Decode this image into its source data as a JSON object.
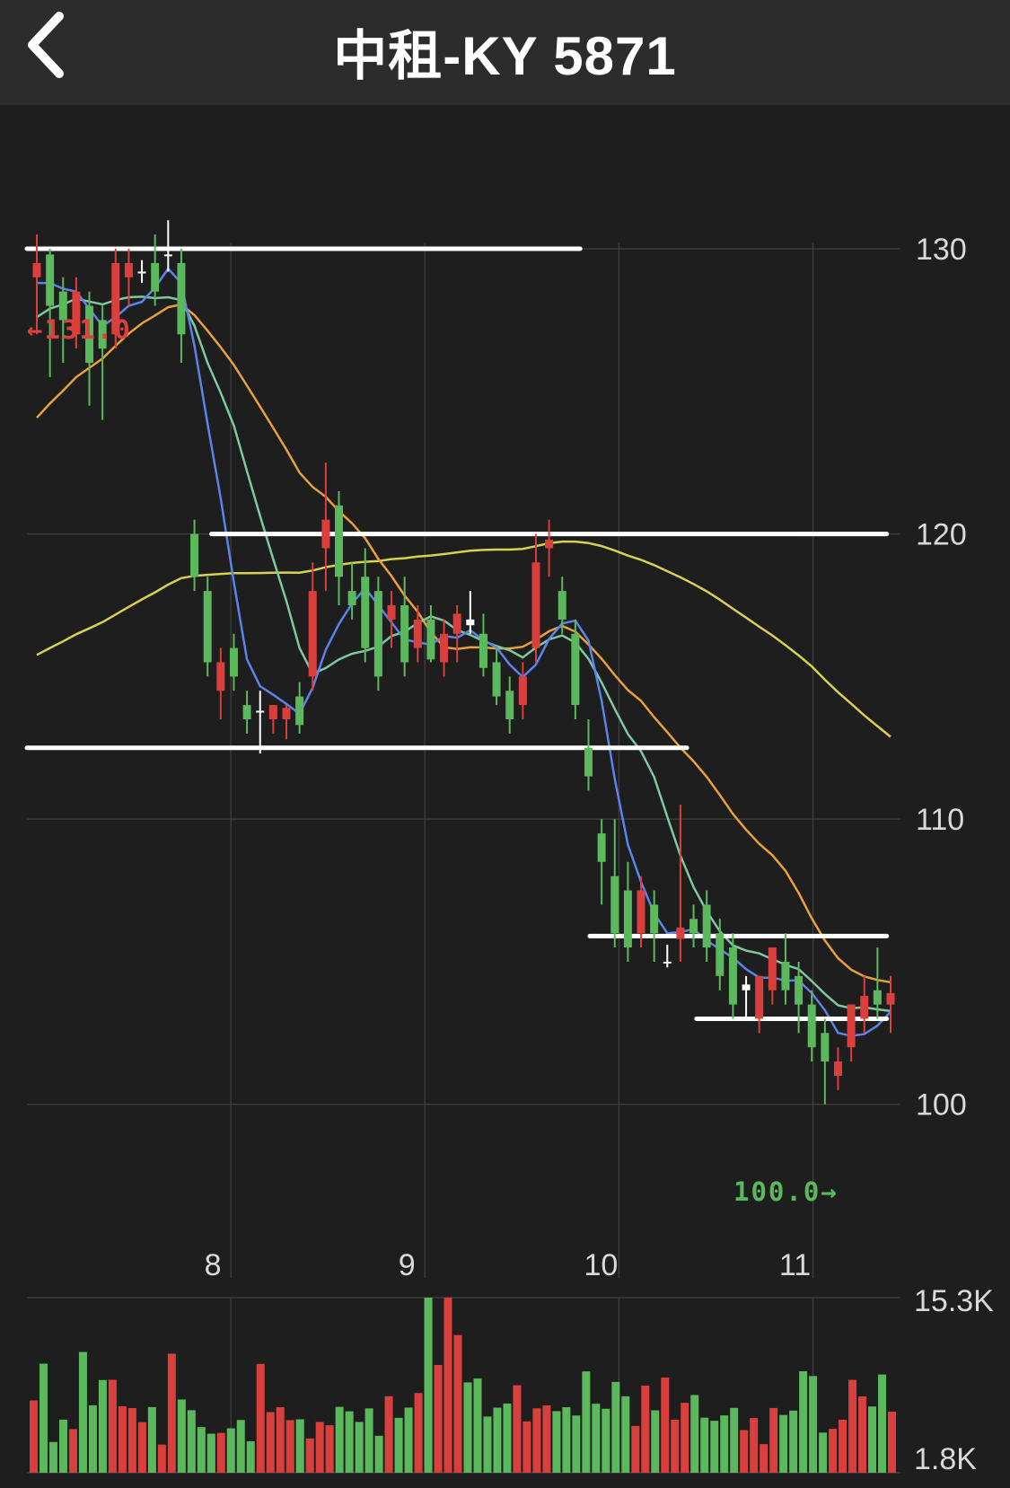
{
  "header": {
    "title": "中租-KY 5871",
    "back_icon": "chevron-left-icon"
  },
  "colors": {
    "up": "#d9403d",
    "down": "#5cb85c",
    "doji": "#ffffff",
    "ma5": "#5b84e8",
    "ma10": "#7ec8a0",
    "ma20": "#e8a03c",
    "ma60": "#d6d150",
    "support_line": "#ffffff",
    "grid": "#3a3a3a"
  },
  "chart_data": [
    {
      "type": "candlestick",
      "y_ticks": [
        "130",
        "120",
        "110",
        "100"
      ],
      "y_tick_values": [
        130,
        120,
        110,
        100
      ],
      "x_tick_labels": [
        "8",
        "9",
        "10",
        "11"
      ],
      "x_tick_index": [
        10,
        20,
        30,
        40
      ],
      "ylim": [
        97,
        134
      ],
      "max_marker": "←131.0",
      "min_marker": "100.0→",
      "horizontal_levels": [
        {
          "y": 130.0,
          "from_index": 0,
          "to_index": 28
        },
        {
          "y": 120.0,
          "from_index": 9,
          "to_index": 43.8
        },
        {
          "y": 112.5,
          "from_index": 0,
          "to_index": 33.5
        },
        {
          "y": 105.9,
          "from_index": 28.5,
          "to_index": 43.8
        },
        {
          "y": 103.0,
          "from_index": 34,
          "to_index": 43.8
        }
      ],
      "candles": [
        {
          "o": 129.0,
          "h": 130.5,
          "l": 127.0,
          "c": 129.5
        },
        {
          "o": 129.8,
          "h": 130.0,
          "l": 125.5,
          "c": 128.0
        },
        {
          "o": 128.5,
          "h": 129.0,
          "l": 126.0,
          "c": 127.5
        },
        {
          "o": 127.0,
          "h": 129.0,
          "l": 126.5,
          "c": 128.5
        },
        {
          "o": 128.0,
          "h": 128.5,
          "l": 124.5,
          "c": 126.0
        },
        {
          "o": 127.5,
          "h": 128.0,
          "l": 124.0,
          "c": 126.5
        },
        {
          "o": 127.0,
          "h": 130.0,
          "l": 126.5,
          "c": 129.5
        },
        {
          "o": 129.0,
          "h": 130.0,
          "l": 128.0,
          "c": 129.5
        },
        {
          "o": 129.2,
          "h": 129.6,
          "l": 128.8,
          "c": 129.2
        },
        {
          "o": 129.5,
          "h": 130.5,
          "l": 128.0,
          "c": 128.5
        },
        {
          "o": 129.8,
          "h": 131.0,
          "l": 129.2,
          "c": 129.8
        },
        {
          "o": 129.5,
          "h": 130.0,
          "l": 126.0,
          "c": 127.0
        },
        {
          "o": 120.0,
          "h": 120.5,
          "l": 118.0,
          "c": 118.5
        },
        {
          "o": 118.0,
          "h": 118.5,
          "l": 115.0,
          "c": 115.5
        },
        {
          "o": 114.5,
          "h": 116.0,
          "l": 113.5,
          "c": 115.5
        },
        {
          "o": 116.0,
          "h": 116.5,
          "l": 114.5,
          "c": 115.0
        },
        {
          "o": 114.0,
          "h": 114.5,
          "l": 113.0,
          "c": 113.5
        },
        {
          "o": 113.8,
          "h": 114.5,
          "l": 112.3,
          "c": 113.8
        },
        {
          "o": 113.5,
          "h": 114.0,
          "l": 113.0,
          "c": 114.0
        },
        {
          "o": 113.5,
          "h": 114.0,
          "l": 112.8,
          "c": 113.9
        },
        {
          "o": 114.3,
          "h": 114.8,
          "l": 113.0,
          "c": 113.3
        },
        {
          "o": 115.0,
          "h": 119.0,
          "l": 114.5,
          "c": 118.0
        },
        {
          "o": 119.5,
          "h": 122.5,
          "l": 118.0,
          "c": 120.5
        },
        {
          "o": 121.0,
          "h": 121.5,
          "l": 117.5,
          "c": 118.5
        },
        {
          "o": 118.0,
          "h": 119.0,
          "l": 117.0,
          "c": 117.5
        },
        {
          "o": 118.5,
          "h": 119.5,
          "l": 115.5,
          "c": 116.0
        },
        {
          "o": 118.0,
          "h": 118.5,
          "l": 114.5,
          "c": 115.0
        }
      ],
      "series_lines": "ma5, ma10, ma20, ma60 (unlabeled)"
    },
    {
      "type": "bar",
      "y_ticks": [
        "15.3K",
        "1.8K"
      ]
    }
  ]
}
